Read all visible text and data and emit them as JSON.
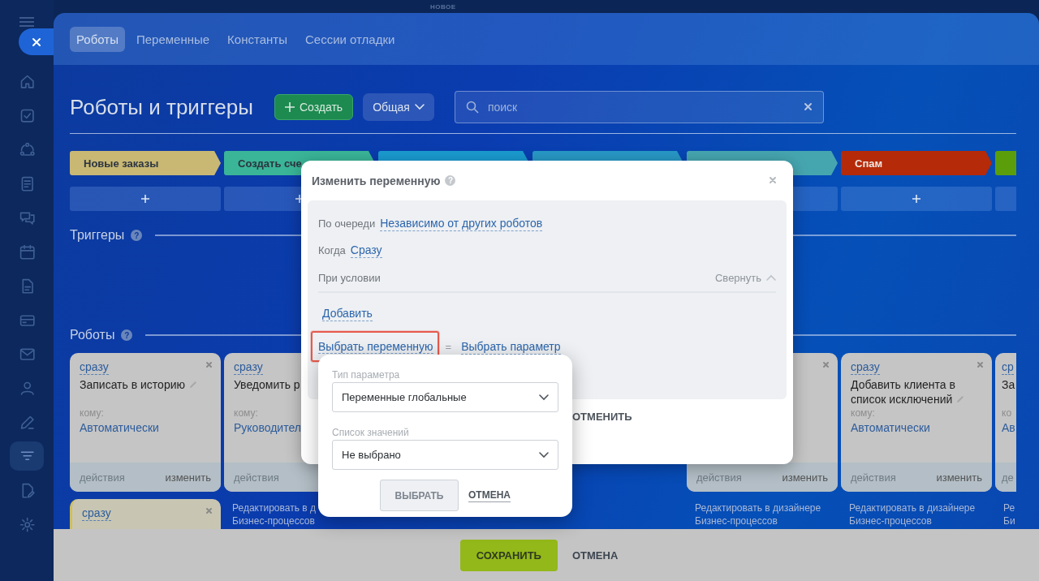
{
  "top_label": "НОВОЕ",
  "sidebar": {
    "items": [
      {
        "selected": false
      },
      {
        "selected": false
      },
      {
        "selected": false
      },
      {
        "selected": false
      },
      {
        "selected": false
      },
      {
        "selected": false
      },
      {
        "selected": false
      },
      {
        "selected": false
      },
      {
        "selected": false
      },
      {
        "selected": false
      },
      {
        "selected": false
      },
      {
        "selected": true
      },
      {
        "selected": false
      },
      {
        "selected": false
      }
    ]
  },
  "tabs": [
    {
      "label": "Роботы",
      "selected": true
    },
    {
      "label": "Переменные",
      "selected": false
    },
    {
      "label": "Константы",
      "selected": false
    },
    {
      "label": "Сессии отладки",
      "selected": false
    }
  ],
  "title": "Роботы и триггеры",
  "create_button": "Создать",
  "view_dropdown": "Общая",
  "search": {
    "placeholder": "поиск"
  },
  "triggers_section": {
    "title": "Триггеры",
    "help": "?"
  },
  "robots_section": {
    "title": "Роботы",
    "help": "?"
  },
  "columns": [
    {
      "stage": {
        "label": "Новые заказы",
        "color": "#c8b874"
      },
      "robot": {
        "delay": "сразу",
        "name": "Записать в историю",
        "to_label": "кому:",
        "to": "Автоматически",
        "actions": "действия",
        "edit": "изменить"
      },
      "extra_robot": {
        "delay": "сразу"
      }
    },
    {
      "stage": {
        "label": "Создать сче",
        "color": "#3ab597"
      },
      "robot": {
        "delay": "сразу",
        "name": "Уведомить р",
        "to_label": "кому:",
        "to": "Руководител",
        "actions": "действия"
      },
      "designer_lines": [
        "Редактировать в д",
        "Бизнес-процессов"
      ]
    },
    {
      "stage": {
        "color": "#1a9bd0"
      }
    },
    {
      "stage": {
        "color": "#2898c6"
      }
    },
    {
      "stage": {
        "color": "#46a6b0"
      },
      "robot": {
        "actions": "действия",
        "edit": "изменить"
      },
      "designer_lines": [
        "Редактировать в дизайнере",
        "Бизнес-процессов"
      ]
    },
    {
      "stage": {
        "label": "Спам",
        "color": "#b52a08"
      },
      "robot": {
        "delay": "сразу",
        "name": "Добавить клиента в список исключений",
        "to_label": "кому:",
        "to": "Автоматически",
        "actions": "действия",
        "edit": "изменить"
      },
      "designer_lines": [
        "Редактировать в дизайнере",
        "Бизнес-процессов"
      ]
    },
    {
      "stage": {
        "color": "#5a9e0c"
      },
      "robot": {
        "delay": "ср",
        "name": "За",
        "to_label": "ко",
        "to": "Ав",
        "actions": "де"
      },
      "designer_lines": [
        "Ре",
        "Би"
      ]
    }
  ],
  "modal": {
    "title": "Изменить переменную",
    "help": "?",
    "rows": [
      {
        "label": "По очереди",
        "value": "Независимо от других роботов"
      },
      {
        "label": "Когда",
        "value": "Сразу"
      }
    ],
    "condition": {
      "label": "При условии",
      "collapse": "Свернуть"
    },
    "add_link": "Добавить",
    "variable_link": "Выбрать переменную",
    "equals": "=",
    "param_link": "Выбрать параметр",
    "cancel_button": "ОТМЕНИТЬ"
  },
  "popup": {
    "fields": [
      {
        "label": "Тип параметра",
        "value": "Переменные глобальные"
      },
      {
        "label": "Список значений",
        "value": "Не выбрано"
      }
    ],
    "select_button": "ВЫБРАТЬ",
    "cancel_link": "ОТМЕНА"
  },
  "footer": {
    "save_button": "СОХРАНИТЬ",
    "cancel_button": "ОТМЕНА"
  }
}
